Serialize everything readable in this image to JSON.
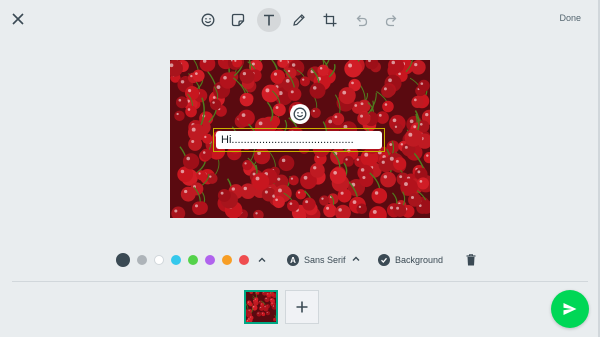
{
  "toolbar": {
    "close_icon": "close-icon",
    "tools": [
      {
        "name": "emoji",
        "icon": "emoji-icon"
      },
      {
        "name": "sticker",
        "icon": "sticker-icon"
      },
      {
        "name": "text",
        "icon": "text-icon",
        "active": true
      },
      {
        "name": "draw",
        "icon": "pencil-icon"
      },
      {
        "name": "crop",
        "icon": "crop-icon"
      },
      {
        "name": "undo",
        "icon": "undo-icon"
      },
      {
        "name": "redo",
        "icon": "redo-icon"
      }
    ],
    "done_label": "Done"
  },
  "canvas": {
    "image": "cherries",
    "text_value": "Hi........................................",
    "emoji_handle_icon": "emoji-icon"
  },
  "text_options": {
    "colors": [
      "#3b4a54",
      "#aeb4b9",
      "#ffffff",
      "#35c8ec",
      "#54d24a",
      "#b063ed",
      "#f79e25",
      "#ef4d4f"
    ],
    "selected_color": "#3b4a54",
    "font_label": "Sans Serif",
    "background_label": "Background"
  },
  "footer": {
    "add_icon": "plus-icon",
    "send_icon": "send-icon"
  },
  "accent": "#00a884",
  "send_color": "#00d756"
}
